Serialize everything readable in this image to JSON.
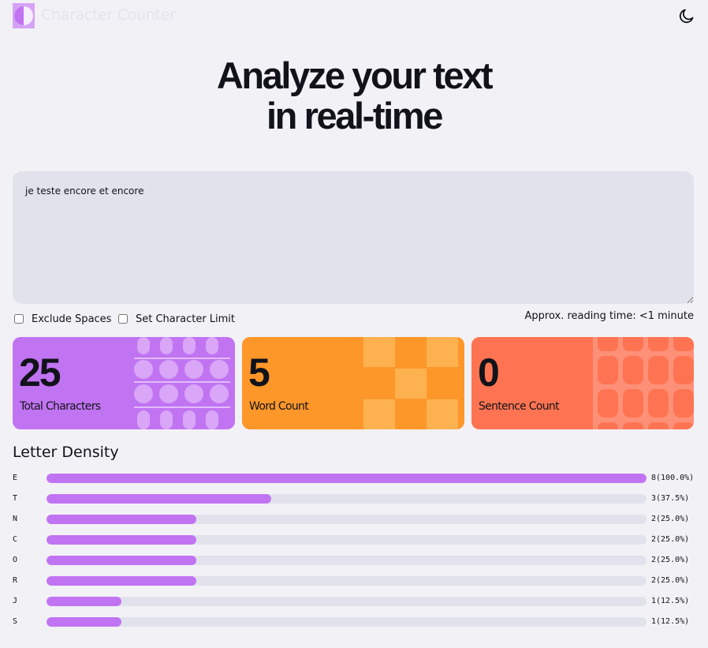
{
  "header": {
    "app_name": "Character Counter",
    "logo_icon": "half-circle-logo-icon",
    "theme_icon": "moon-icon"
  },
  "hero": {
    "line1": "Analyze your text",
    "line2": "in real-time"
  },
  "editor": {
    "value": "je teste encore et encore"
  },
  "options": {
    "exclude_spaces_label": "Exclude Spaces",
    "exclude_spaces_checked": false,
    "char_limit_label": "Set Character Limit",
    "char_limit_checked": false,
    "reading_time": "Approx. reading time: <1 minute"
  },
  "stats": {
    "total_characters": {
      "value": "25",
      "label": "Total Characters",
      "color": "#c174f2"
    },
    "word_count": {
      "value": "5",
      "label": "Word Count",
      "color": "#fe972a"
    },
    "sentence_count": {
      "value": "0",
      "label": "Sentence Count",
      "color": "#fe7452"
    }
  },
  "density": {
    "title": "Letter Density",
    "rows": [
      {
        "letter": "E",
        "fraction": 1.0,
        "count": "8(100.0%)"
      },
      {
        "letter": "T",
        "fraction": 0.375,
        "count": "3(37.5%)"
      },
      {
        "letter": "N",
        "fraction": 0.25,
        "count": "2(25.0%)"
      },
      {
        "letter": "C",
        "fraction": 0.25,
        "count": "2(25.0%)"
      },
      {
        "letter": "O",
        "fraction": 0.25,
        "count": "2(25.0%)"
      },
      {
        "letter": "R",
        "fraction": 0.25,
        "count": "2(25.0%)"
      },
      {
        "letter": "J",
        "fraction": 0.125,
        "count": "1(12.5%)"
      },
      {
        "letter": "S",
        "fraction": 0.125,
        "count": "1(12.5%)"
      }
    ]
  },
  "colors": {
    "accent": "#c174f2",
    "bar_track": "#e2e2ec",
    "background": "#f2f1f6"
  }
}
